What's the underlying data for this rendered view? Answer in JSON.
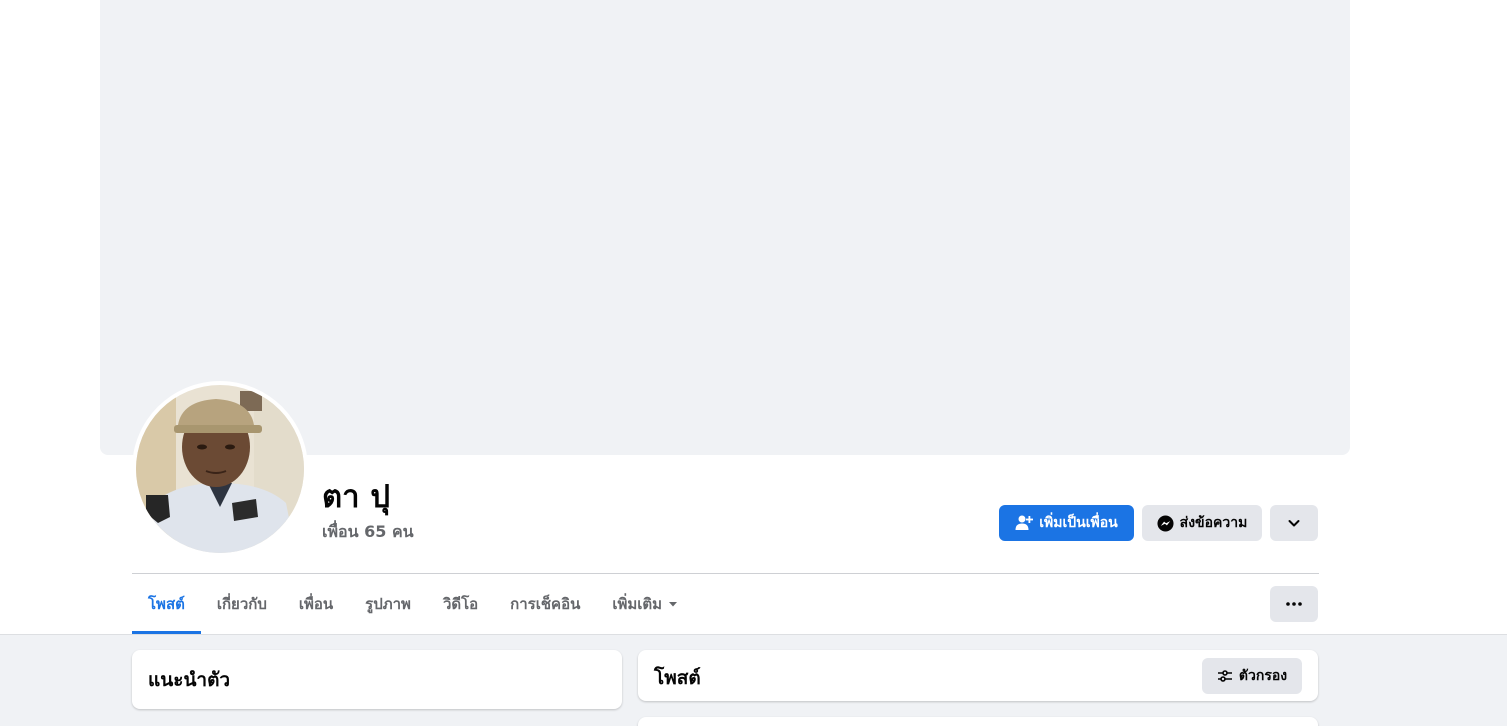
{
  "profile": {
    "name": "ตา ปุ",
    "friends_count": "เพื่อน 65 คน"
  },
  "actions": {
    "add_friend_label": "เพิ่มเป็นเพื่อน",
    "message_label": "ส่งข้อความ"
  },
  "tabs": [
    {
      "label": "โพสต์",
      "active": true
    },
    {
      "label": "เกี่ยวกับ"
    },
    {
      "label": "เพื่อน"
    },
    {
      "label": "รูปภาพ"
    },
    {
      "label": "วิดีโอ"
    },
    {
      "label": "การเช็คอิน"
    },
    {
      "label": "เพิ่มเติม"
    }
  ],
  "intro": {
    "title": "แนะนำตัว"
  },
  "posts": {
    "title": "โพสต์",
    "filter_label": "ตัวกรอง"
  },
  "colors": {
    "accent": "#1b74e4",
    "secondary_text": "#65676b",
    "background": "#f0f2f5"
  }
}
